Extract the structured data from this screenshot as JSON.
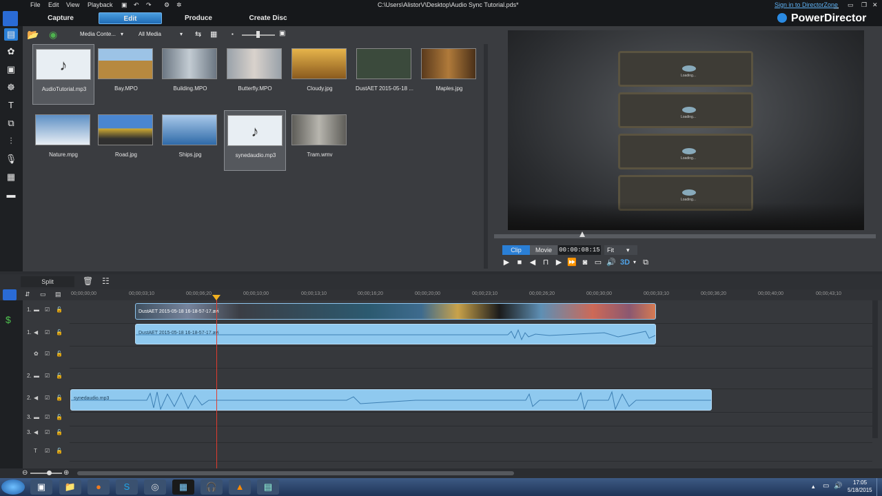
{
  "menus": [
    "File",
    "Edit",
    "View",
    "Playback"
  ],
  "window_title": "C:\\Users\\AlistorV\\Desktop\\Audio Sync Tutorial.pds*",
  "sign_in": "Sign in to DirectorZone",
  "brand": "PowerDirector",
  "modes": {
    "capture": "Capture",
    "edit": "Edit",
    "produce": "Produce",
    "create_disc": "Create Disc"
  },
  "library": {
    "content_dropdown": "Media Conte...",
    "filter_dropdown": "All Media",
    "items": [
      {
        "name": "AudioTutorial.mp3",
        "color": "#e8eef3"
      },
      {
        "name": "Bay.MPO",
        "color": "#b7893f"
      },
      {
        "name": "Building.MPO",
        "color": "#8d98a3"
      },
      {
        "name": "Butterfly.MPO",
        "color": "#c7c1bc"
      },
      {
        "name": "Cloudy.jpg",
        "color": "#c98d2e"
      },
      {
        "name": "DustAET 2015-05-18 ...",
        "color": "#3b4a3c"
      },
      {
        "name": "Maples.jpg",
        "color": "#7e4e28"
      },
      {
        "name": "Nature.mpg",
        "color": "#6e99c5"
      },
      {
        "name": "Road.jpg",
        "color": "#d2ad33"
      },
      {
        "name": "Ships.jpg",
        "color": "#3f79b5"
      },
      {
        "name": "synedaudio.mp3",
        "color": "#e8eef3"
      },
      {
        "name": "Tram.wmv",
        "color": "#8f8e89"
      }
    ]
  },
  "preview": {
    "loading_text": "Loading...",
    "clip_tab": "Clip",
    "movie_tab": "Movie",
    "timecode": "00:00:08:15",
    "fit": "Fit",
    "mode_3d": "3D"
  },
  "timeline": {
    "split_label": "Split",
    "ruler": [
      "00;00;00;00",
      "00;00;03;10",
      "00;00;06;20",
      "00;00;10;00",
      "00;00;13;10",
      "00;00;16;20",
      "00;00;20;00",
      "00;00;23;10",
      "00;00;26;20",
      "00;00;30;00",
      "00;00;33;10",
      "00;00;36;20",
      "00;00;40;00",
      "00;00;43;10"
    ],
    "tracks": [
      "1.",
      "1.",
      "",
      "2.",
      "2.",
      "3.",
      "3.",
      "T"
    ],
    "video_clip": "DustAET 2015-05-18 16-18-57-17.avi",
    "audio_clip": "DustAET 2015-05-18 16-18-57-17.avi",
    "audio2_clip": "synedaudio.mp3",
    "playhead_color": "#e23b2d"
  },
  "taskbar": {
    "time": "17:05",
    "date": "5/18/2015",
    "icons": [
      "windows-start-icon",
      "file-explorer-icon",
      "folder-icon",
      "firefox-icon",
      "skype-icon",
      "steam-icon",
      "powerdirector-icon",
      "headphones-icon",
      "vlc-icon",
      "app-icon"
    ]
  }
}
